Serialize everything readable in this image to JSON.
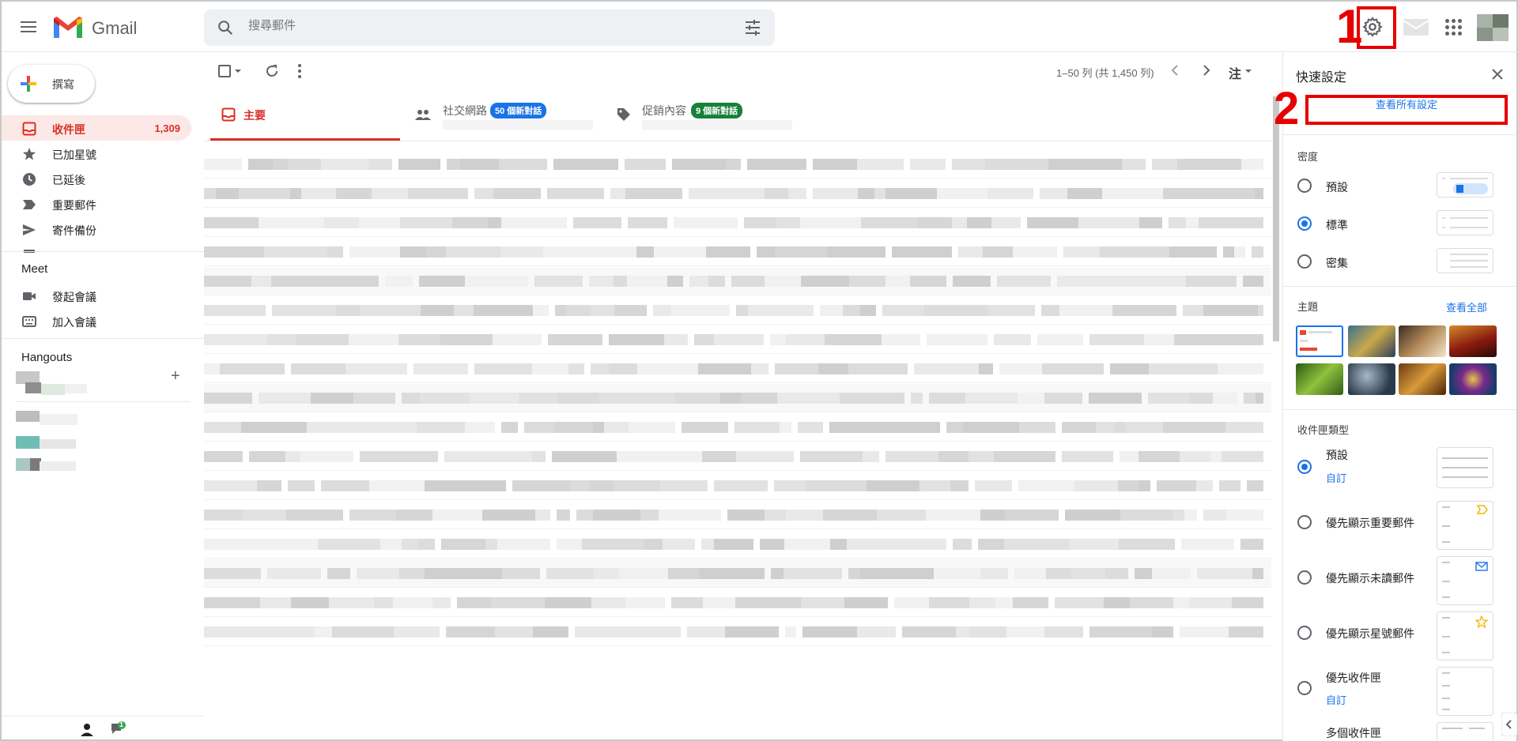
{
  "app": {
    "name": "Gmail"
  },
  "search": {
    "placeholder": "搜尋郵件"
  },
  "compose": {
    "label": "撰寫"
  },
  "sidebar": {
    "items": [
      {
        "label": "收件匣",
        "count": "1,309",
        "active": true,
        "icon": "inbox-icon"
      },
      {
        "label": "已加星號",
        "count": "",
        "icon": "star-icon"
      },
      {
        "label": "已延後",
        "count": "",
        "icon": "clock-icon"
      },
      {
        "label": "重要郵件",
        "count": "",
        "icon": "important-icon"
      },
      {
        "label": "寄件備份",
        "count": "",
        "icon": "send-icon"
      }
    ],
    "meet": {
      "title": "Meet",
      "items": [
        {
          "label": "發起會議",
          "icon": "video-icon"
        },
        {
          "label": "加入會議",
          "icon": "keyboard-icon"
        }
      ]
    },
    "hangouts": {
      "title": "Hangouts"
    },
    "chat_badge": "1"
  },
  "toolbar": {
    "pager": "1–50 列 (共 1,450 列)",
    "input_tools": "注"
  },
  "tabs": [
    {
      "label": "主要",
      "active": true,
      "icon": "inbox-icon"
    },
    {
      "label": "社交網路",
      "badge": "50 個新對話",
      "badge_color": "#1a73e8",
      "icon": "people-icon"
    },
    {
      "label": "促銷內容",
      "badge": "9 個新對話",
      "badge_color": "#188038",
      "icon": "tag-icon"
    }
  ],
  "quick_settings": {
    "title": "快速設定",
    "see_all": "查看所有設定",
    "density": {
      "title": "密度",
      "options": [
        "預設",
        "標準",
        "密集"
      ],
      "selected": 1
    },
    "theme": {
      "title": "主題",
      "see_all": "查看全部"
    },
    "inbox_type": {
      "title": "收件匣類型",
      "options": [
        {
          "label": "預設",
          "link": "自訂",
          "selected": true
        },
        {
          "label": "優先顯示重要郵件"
        },
        {
          "label": "優先顯示未讀郵件"
        },
        {
          "label": "優先顯示星號郵件"
        },
        {
          "label": "優先收件匣",
          "link": "自訂"
        },
        {
          "label": "多個收件匣"
        }
      ]
    }
  },
  "annotations": {
    "step1": "1",
    "step2": "2"
  },
  "colors": {
    "accent_red": "#d93025",
    "annotation_red": "#e60000",
    "link_blue": "#1a73e8"
  }
}
